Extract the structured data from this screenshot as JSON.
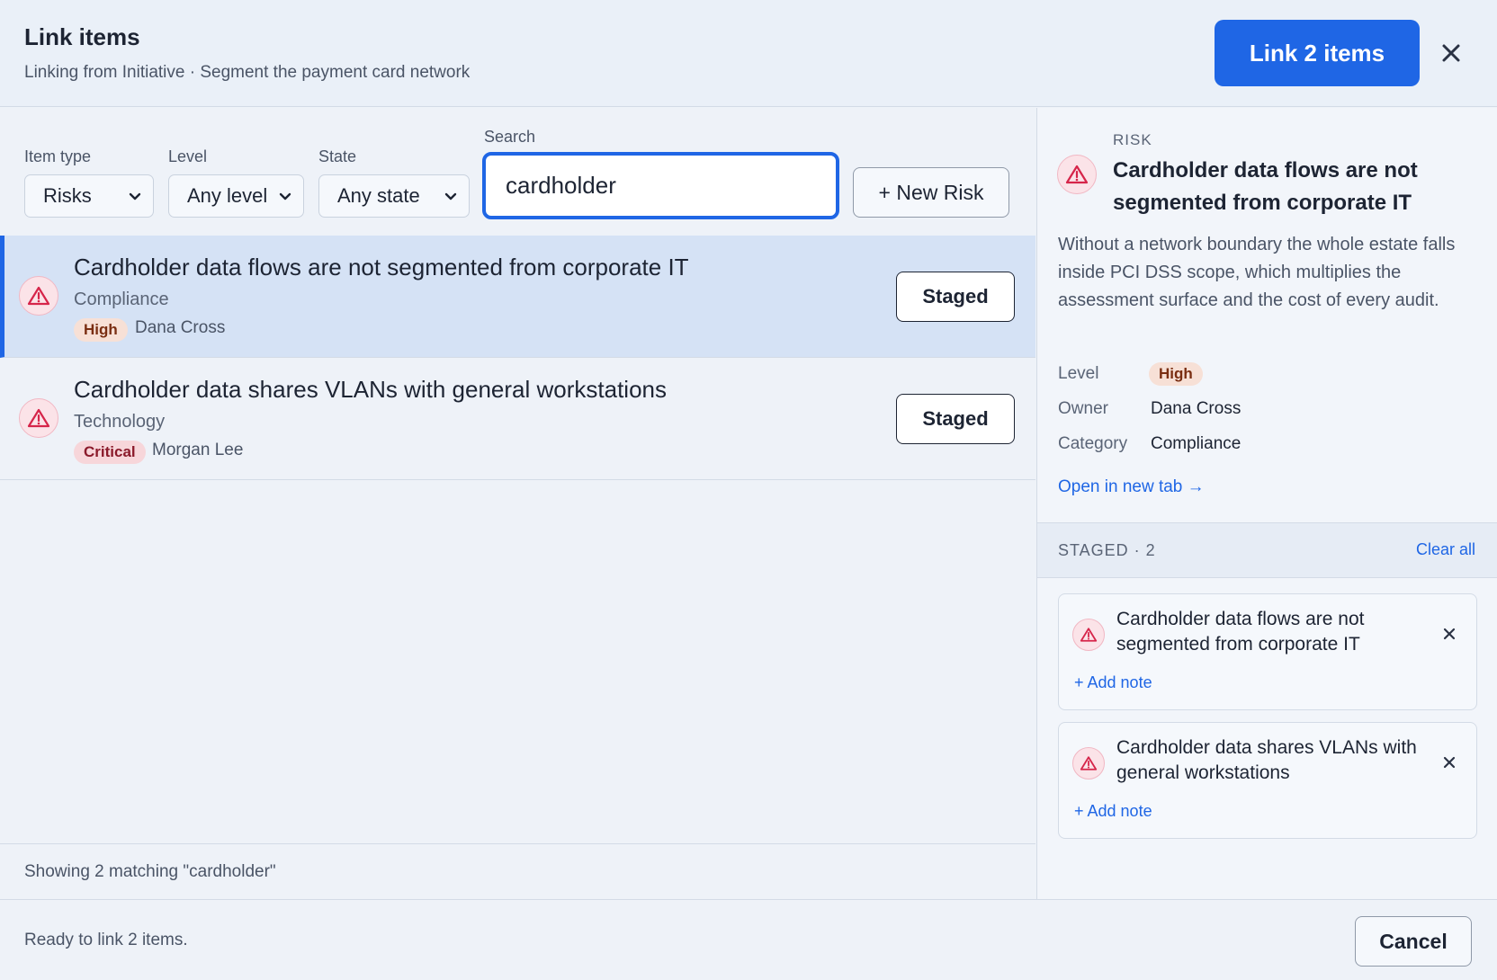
{
  "header": {
    "title": "Link items",
    "subtitle": "Linking from Initiative · Segment the payment card network",
    "primary_label": "Link 2 items"
  },
  "filters": {
    "item_type_label": "Item type",
    "item_type_value": "Risks",
    "level_label": "Level",
    "level_value": "Any level",
    "state_label": "State",
    "state_value": "Any state",
    "search_label": "Search",
    "search_value": "cardholder",
    "new_button": "+ New Risk"
  },
  "results": [
    {
      "title": "Cardholder data flows are not segmented from corporate IT",
      "category": "Compliance",
      "level": "High",
      "owner": "Dana Cross",
      "action": "Staged",
      "selected": true
    },
    {
      "title": "Cardholder data shares VLANs with general workstations",
      "category": "Technology",
      "level": "Critical",
      "owner": "Morgan Lee",
      "action": "Staged",
      "selected": false
    }
  ],
  "list_footer": "Showing 2 matching \"cardholder\"",
  "detail": {
    "kicker": "RISK",
    "title": "Cardholder data flows are not segmented from corporate IT",
    "description": "Without a network boundary the whole estate falls inside PCI DSS scope, which multiplies the assessment surface and the cost of every audit.",
    "level_label": "Level",
    "level_value": "High",
    "owner_label": "Owner",
    "owner_value": "Dana Cross",
    "category_label": "Category",
    "category_value": "Compliance",
    "open_link": "Open in new tab →"
  },
  "staged": {
    "header": "STAGED · 2",
    "clear_label": "Clear all",
    "items": [
      {
        "title": "Cardholder data flows are not segmented from corporate IT",
        "note": "+ Add note"
      },
      {
        "title": "Cardholder data shares VLANs with general workstations",
        "note": "+ Add note"
      }
    ]
  },
  "footer": {
    "status": "Ready to link 2 items.",
    "cancel_label": "Cancel"
  },
  "colors": {
    "accent": "#1f66e5",
    "risk_icon": "#d6254a",
    "high_badge": "#f7e0d6",
    "critical_badge": "#f7d6da"
  },
  "icons": {
    "risk": "warning-triangle-icon",
    "close": "close-icon",
    "dropdown": "chevron-down-icon"
  }
}
